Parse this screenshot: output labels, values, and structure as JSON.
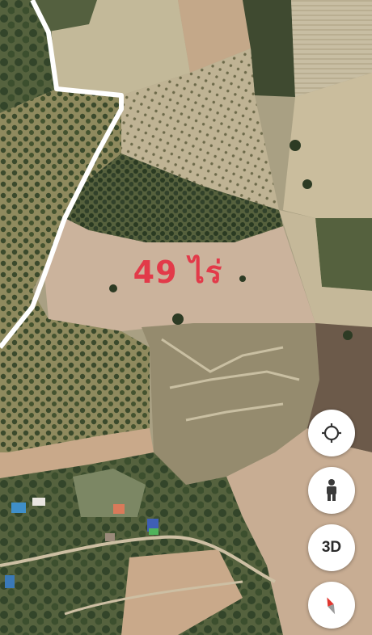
{
  "map": {
    "area_label": "49 ไร่",
    "label_color": "#e23a49",
    "boundary_color": "#ffffff"
  },
  "controls": {
    "locate_icon": "crosshair-icon",
    "street_view_icon": "pegman-icon",
    "three_d_label": "3D",
    "compass_icon": "compass-icon"
  }
}
